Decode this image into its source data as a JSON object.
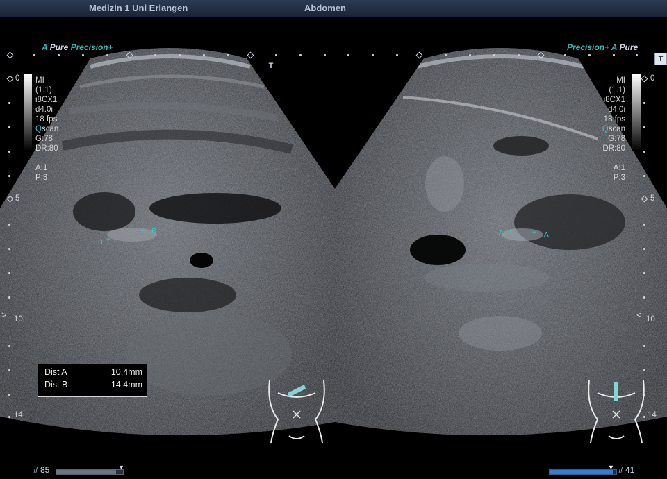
{
  "header": {
    "institution": "Medizin 1 Uni Erlangen",
    "exam": "Abdomen"
  },
  "brand": {
    "left_a": "A",
    "left_pure": "Pure",
    "left_precision": "Precision+",
    "right_precision": "Precision+",
    "right_a": "A",
    "right_pure": "Pure"
  },
  "left_params": {
    "mi_label": "MI",
    "mi_value": "(1.1)",
    "probe": "i8CX1",
    "depth": "d4.0i",
    "fps": "18 fps",
    "qscan_q": "Q",
    "qscan_rest": "scan",
    "gain": "G:78",
    "dr": "DR:80",
    "a": "A:1",
    "p": "P:3"
  },
  "right_params": {
    "mi_label": "MI",
    "mi_value": "(1.1)",
    "probe": "i8CX1",
    "depth": "d4.0i",
    "fps": "18 fps",
    "qscan_q": "Q",
    "qscan_rest": "scan",
    "gain": "G:78",
    "dr": "DR:80",
    "a": "A:1",
    "p": "P:3"
  },
  "depth_scale": {
    "d0": "0",
    "d5": "5",
    "d10": "10",
    "d14": "14"
  },
  "measurements": {
    "dist_a_label": "Dist A",
    "dist_a_value": "10.4mm",
    "dist_b_label": "Dist B",
    "dist_b_value": "14.4mm"
  },
  "markers": {
    "b": "B",
    "a": "A",
    "plus": "+"
  },
  "buttons": {
    "t_left": "T",
    "t_right": "T"
  },
  "footer": {
    "left_frame": "# 85",
    "right_frame": "# 41",
    "left_progress": 0.9,
    "right_progress": 0.95
  },
  "colors": {
    "accent": "#2fb6b0",
    "marker": "#3fc8c8",
    "progress": "#2e7fd6",
    "header": "#1b2438"
  }
}
